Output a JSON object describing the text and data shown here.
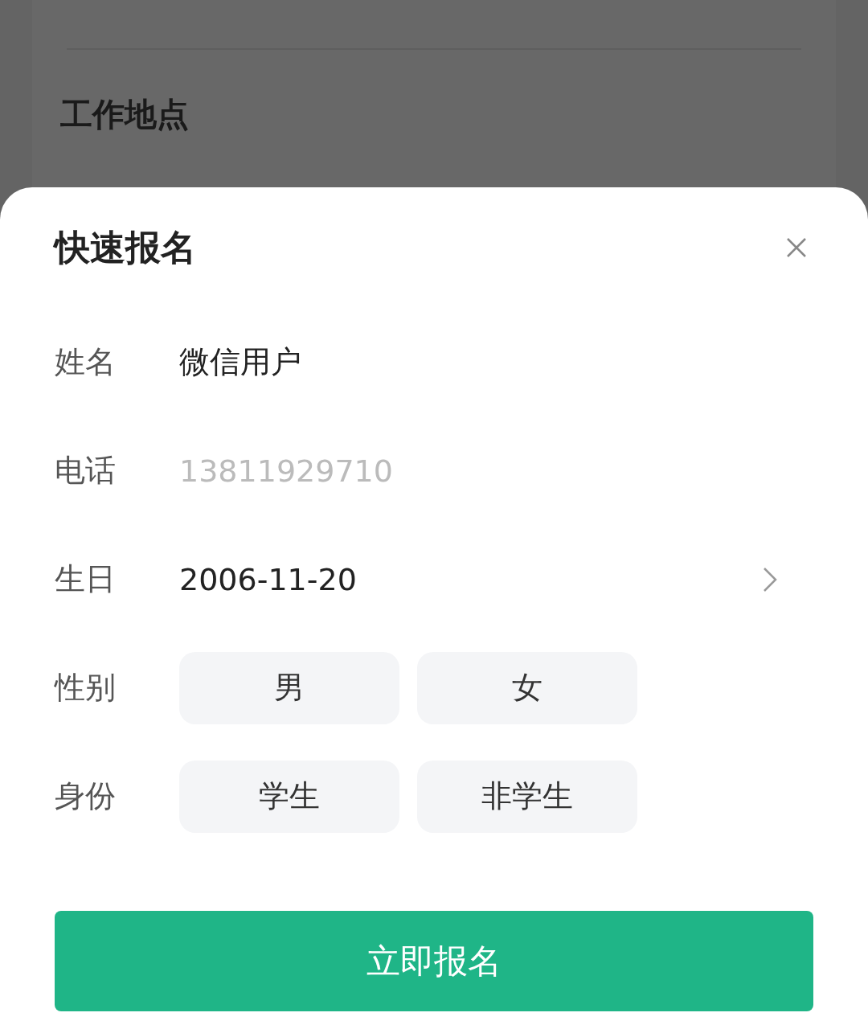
{
  "background": {
    "section_title": "工作地点"
  },
  "sheet": {
    "title": "快速报名",
    "fields": [
      {
        "kind": "text",
        "label": "姓名",
        "value": "微信用户"
      },
      {
        "kind": "input",
        "label": "电话",
        "placeholder": "13811929710"
      },
      {
        "kind": "picker",
        "label": "生日",
        "value": "2006-11-20"
      },
      {
        "kind": "choice",
        "label": "性别",
        "options": [
          {
            "label": "男",
            "selected": false
          },
          {
            "label": "女",
            "selected": false
          }
        ]
      },
      {
        "kind": "choice",
        "label": "身份",
        "options": [
          {
            "label": "学生",
            "selected": false
          },
          {
            "label": "非学生",
            "selected": false
          }
        ]
      }
    ],
    "submit": "立即报名"
  }
}
